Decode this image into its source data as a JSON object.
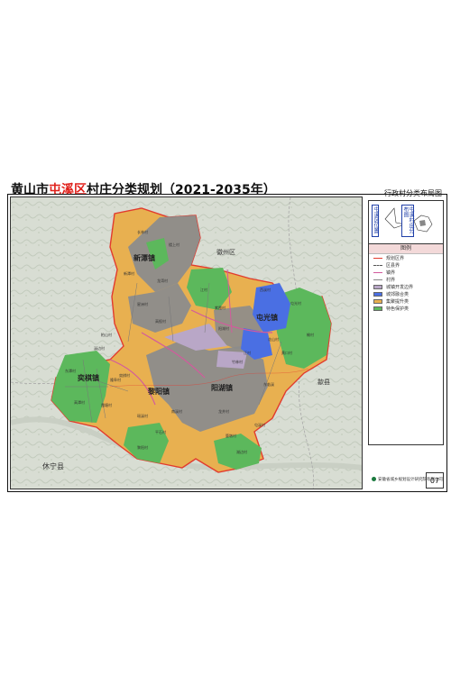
{
  "title": {
    "prefix": "黄山市",
    "highlight": "屯溪区",
    "suffix": "村庄分类规划（2021-2035年）"
  },
  "subtitle": "行政村分类布局图",
  "location_labels": {
    "label_a": "屯溪区位置",
    "label_b": "屯溪村庄分布图"
  },
  "legend": {
    "title": "图例",
    "items": [
      {
        "label": "规划区界",
        "color": "#e23b2e",
        "style": "line"
      },
      {
        "label": "区县界",
        "color": "#555555",
        "style": "dash"
      },
      {
        "label": "镇界",
        "color": "#d35a9d",
        "style": "line"
      },
      {
        "label": "村界",
        "color": "#888888",
        "style": "line"
      },
      {
        "label": "城镇开发边界",
        "color": "#b9a7c7",
        "style": "fill"
      },
      {
        "label": "城郊融合类",
        "color": "#4a6fe3",
        "style": "fill"
      },
      {
        "label": "集聚提升类",
        "color": "#e8b050",
        "style": "fill"
      },
      {
        "label": "特色保护类",
        "color": "#5cb85c",
        "style": "fill"
      }
    ]
  },
  "credit": "安徽省城乡规划设计研究院有限公司",
  "page_number": "07",
  "map_labels": {
    "region_north": "徽州区",
    "region_east": "歙县",
    "region_southwest": "休宁县"
  },
  "towns": [
    {
      "name": "新潭镇"
    },
    {
      "name": "屯光镇"
    },
    {
      "name": "奕棋镇"
    },
    {
      "name": "黎阳镇"
    },
    {
      "name": "阳湖镇"
    }
  ],
  "villages": [
    {
      "name": "长林村"
    },
    {
      "name": "楼上村"
    },
    {
      "name": "新潭村"
    },
    {
      "name": "龙湾村"
    },
    {
      "name": "江村"
    },
    {
      "name": "紫霞村"
    },
    {
      "name": "星洲村"
    },
    {
      "name": "高枧村"
    },
    {
      "name": "阳湖村"
    },
    {
      "name": "屯光村"
    },
    {
      "name": "榆村"
    },
    {
      "name": "黄口村"
    },
    {
      "name": "花山村"
    },
    {
      "name": "西溪村"
    },
    {
      "name": "汪村"
    },
    {
      "name": "东临溪"
    },
    {
      "name": "柏山村"
    },
    {
      "name": "溪边村"
    },
    {
      "name": "东潭村"
    },
    {
      "name": "隆阜村"
    },
    {
      "name": "高潭村"
    },
    {
      "name": "霞塘村"
    },
    {
      "name": "奕棋村"
    },
    {
      "name": "瑶溪村"
    },
    {
      "name": "平石村"
    },
    {
      "name": "黎阳村"
    },
    {
      "name": "龙井村"
    },
    {
      "name": "篁墩村"
    },
    {
      "name": "湖边村"
    },
    {
      "name": "南溪村"
    },
    {
      "name": "竹林村"
    },
    {
      "name": "屯溪村"
    }
  ]
}
